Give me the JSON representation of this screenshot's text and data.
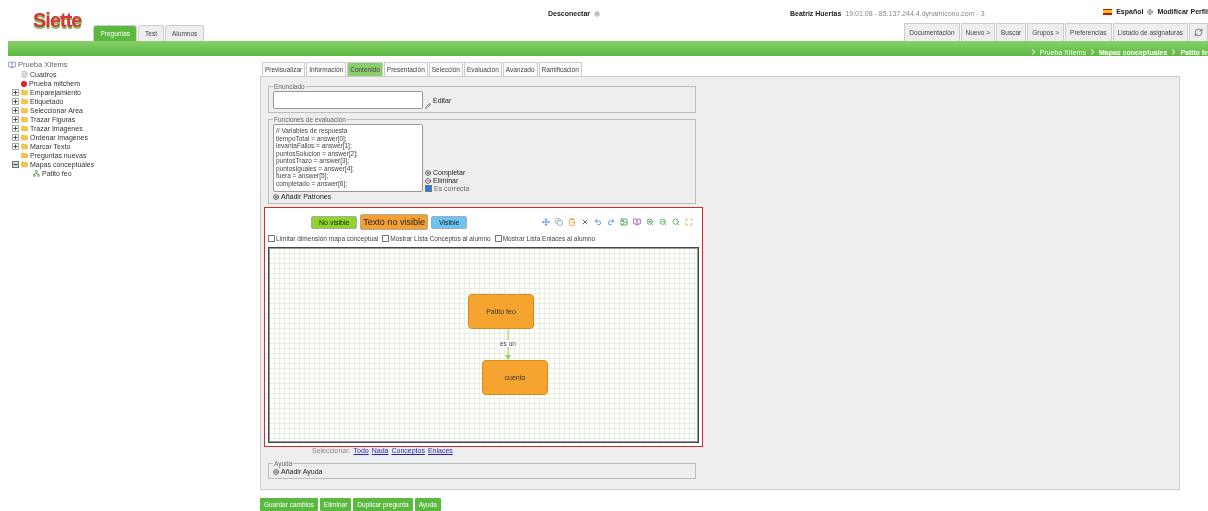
{
  "header": {
    "logo": "Siette",
    "tabs": [
      {
        "label": "Preguntas",
        "selected": true
      },
      {
        "label": "Test",
        "selected": false
      },
      {
        "label": "Alumnos",
        "selected": false
      }
    ],
    "logout": "Desconectar",
    "user": "Beatriz Huertas",
    "session": "19:01:08 - 85.137.244.4.dynamicono.com - 3",
    "language": "Español",
    "profile": "Modificar Perfil",
    "menu": [
      "Documentación",
      "Nuevo >",
      "Buscar",
      "Grupos >",
      "Preferencias",
      "Listado de asignaturas"
    ]
  },
  "breadcrumb": [
    {
      "label": "Prueba XItems",
      "current": false
    },
    {
      "label": "Mapas conceptuales",
      "current": true
    },
    {
      "label": "Patito fe",
      "current": true
    }
  ],
  "tree": {
    "label": "Prueba XItems",
    "children": [
      {
        "label": "Cuadros",
        "kind": "file"
      },
      {
        "label": "Prueba mitchem",
        "kind": "dot"
      },
      {
        "label": "Emparejamiento",
        "kind": "folder",
        "expanded": false
      },
      {
        "label": "Etiquetado",
        "kind": "folder",
        "expanded": false
      },
      {
        "label": "Seleccionar Area",
        "kind": "folder",
        "expanded": false
      },
      {
        "label": "Trazar Figuras",
        "kind": "folder",
        "expanded": false
      },
      {
        "label": "Trazar Imagenes",
        "kind": "folder",
        "expanded": false
      },
      {
        "label": "Ordenar imagenes",
        "kind": "folder",
        "expanded": false
      },
      {
        "label": "Marcar Texto",
        "kind": "folder",
        "expanded": false
      },
      {
        "label": "Preguntas nuevas",
        "kind": "leaf-folder"
      },
      {
        "label": "Mapas conceptuales",
        "kind": "folder",
        "expanded": true,
        "children": [
          {
            "label": "Patito feo",
            "kind": "map"
          }
        ]
      }
    ]
  },
  "tabs": [
    {
      "label": "Previsualizar",
      "selected": false
    },
    {
      "label": "Información",
      "selected": false
    },
    {
      "label": "Contenido",
      "selected": true
    },
    {
      "label": "Presentación",
      "selected": false
    },
    {
      "label": "Selección",
      "selected": false
    },
    {
      "label": "Evaluación",
      "selected": false
    },
    {
      "label": "Avanzado",
      "selected": false
    },
    {
      "label": "Ramificación",
      "selected": false
    }
  ],
  "statement": {
    "legend": "Enunciado",
    "edit": "Editar"
  },
  "evaluation": {
    "legend": "Funciones de evaluación",
    "code": [
      "// Variables de respuesta",
      "tiempoTotal = answer[0];",
      "levantaFallos = answer[1];",
      "puntosSolucion = answer[2];",
      "puntosTrazo = answer[3];",
      "puntosIguales = answer[4];",
      "fuera = answer[5];",
      "completado = answer[6];"
    ],
    "complete": "Completar",
    "delete": "Eliminar",
    "correct": {
      "label": "Es correcta",
      "checked": true
    },
    "add_patterns": "Añadir Patrones"
  },
  "map_editor": {
    "legend": [
      {
        "label": "No visible",
        "color": "#8fd42a"
      },
      {
        "label": "Texto no visible",
        "color": "#f5a030"
      },
      {
        "label": "Visible",
        "color": "#6cc4f5"
      }
    ],
    "options": [
      {
        "label": "Limitar dimensión mapa conceptual",
        "checked": false
      },
      {
        "label": "Mostrar Lista Conceptos al alumno",
        "checked": false
      },
      {
        "label": "Mostrar Lista Enlaces al alumno",
        "checked": false
      }
    ],
    "nodes": [
      {
        "label": "Patito feo"
      },
      {
        "label": "cuento"
      }
    ],
    "link": "es un",
    "select_label": "Seleccionar:",
    "select_links": [
      "Todo",
      "Nada",
      "Conceptos",
      "Enlaces"
    ]
  },
  "help": {
    "legend": "Ayuda",
    "add": "Añadir Ayuda"
  },
  "buttons": [
    "Guardar cambios",
    "Eliminar",
    "Duplicar pregunta",
    "Ayuda"
  ]
}
